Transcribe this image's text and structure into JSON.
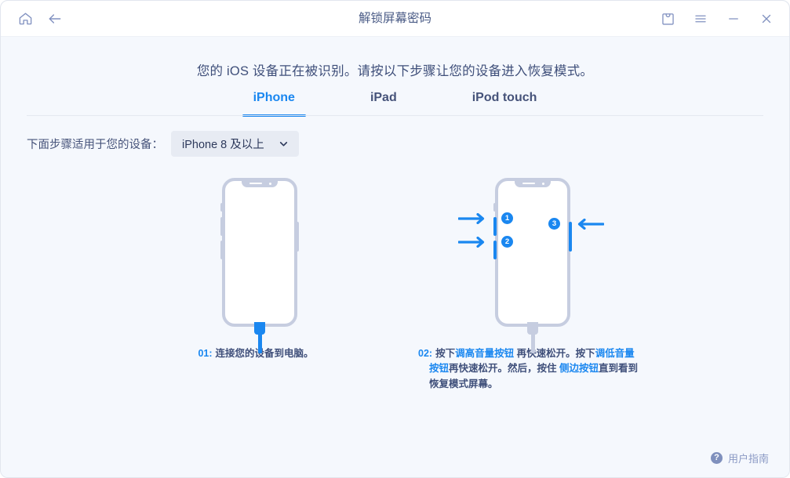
{
  "window": {
    "title": "解锁屏幕密码",
    "titlebar_icons": {
      "home": "home-icon",
      "back": "back-arrow-icon",
      "store": "shopping-bag-icon",
      "menu": "hamburger-menu-icon",
      "minimize": "minimize-icon",
      "close": "close-icon"
    }
  },
  "main": {
    "headline": "您的 iOS 设备正在被识别。请按以下步骤让您的设备进入恢复模式。",
    "tabs": [
      {
        "label": "iPhone",
        "active": true
      },
      {
        "label": "iPad",
        "active": false
      },
      {
        "label": "iPod touch",
        "active": false
      }
    ],
    "selector": {
      "label": "下面步骤适用于您的设备：",
      "value": "iPhone 8 及以上",
      "chevron": "chevron-down-icon"
    },
    "steps": [
      {
        "number": "01:",
        "text": "连接您的设备到电脑。"
      },
      {
        "number": "02:",
        "parts": [
          {
            "text": "按下",
            "highlight": false
          },
          {
            "text": "调高音量按钮",
            "highlight": true
          },
          {
            "text": " 再快速松开。按下",
            "highlight": false
          },
          {
            "text": "调低音量按钮",
            "highlight": true
          },
          {
            "text": "再快速松开。然后，按住 ",
            "highlight": false
          },
          {
            "text": "侧边按钮",
            "highlight": true
          },
          {
            "text": "直到看到恢复模式屏幕。",
            "highlight": false
          }
        ]
      }
    ],
    "badges": [
      "1",
      "2",
      "3"
    ]
  },
  "footer": {
    "help_label": "用户指南",
    "help_icon": "question-mark-icon"
  },
  "colors": {
    "accent": "#1a87f0",
    "body_bg": "#f5f8fd",
    "titlebar_bg": "#ffffff",
    "text": "#3f4f7a",
    "device_outline": "#c6cde0"
  }
}
